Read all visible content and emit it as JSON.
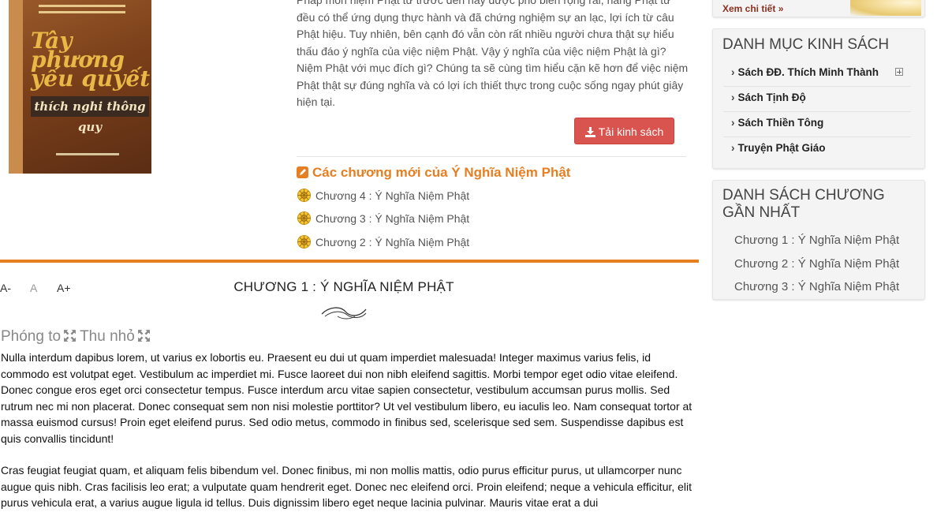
{
  "book": {
    "cover_title": "Tây phương yếu quyết",
    "cover_author": "thích nghi thông quy",
    "description": "Pháp môn niệm Phật từ trước đến nay được phổ biến rộng rãi, hàng Phật tử đều có thể ứng dụng thực hành và đã chứng nghiệm sự an lạc, lợi ích từ câu Phật hiệu. Tuy nhiên, bên cạnh đó vẫn còn rất nhiều người chưa thật sự hiểu thấu đáo ý nghĩa của việc niệm Phật. Vậy ý nghĩa của việc niệm Phật là gì? Niệm Phật với mục đích gì? Chúng ta sẽ cùng tìm hiểu cặn kẽ hơn để việc niệm Phật thật sự đúng nghĩa và có lợi ích thiết thực trong cuộc sống ngay phút giây hiện tại.",
    "download_label": "Tải kinh sách"
  },
  "new_chapters": {
    "title": "Các chương mới của Ý Nghĩa Niệm Phật",
    "items": [
      "Chương 4 : Ý Nghĩa Niệm Phật",
      "Chương 3 : Ý Nghĩa Niệm Phật",
      "Chương 2 : Ý Nghĩa Niệm Phật"
    ]
  },
  "reader": {
    "font_decrease": "A-",
    "font_normal": "A",
    "font_increase": "A+",
    "chapter_title": "CHƯƠNG 1 : Ý NGHĨA NIỆM PHẬT",
    "zoom_in": "Phóng to",
    "zoom_out": "Thu nhỏ",
    "paragraphs": [
      "Nulla interdum dapibus lorem, ut varius ex lobortis eu. Praesent eu dui ut quam imperdiet malesuada! Integer maximus varius felis, id commodo est volutpat eget. Vestibulum ac imperdiet mi. Fusce laoreet dui non nibh eleifend sagittis. Morbi tempor eget odio vitae eleifend. Donec congue eros eget orci consectetur tempus. Fusce interdum arcu vitae sapien consectetur, vestibulum accumsan purus mollis. Sed rutrum nec mi non placerat. Donec consequat sem non nisi molestie porttitor? Ut vel vestibulum libero, eu iaculis leo. Nam consequat tortor at massa euismod cursus! Proin eget eleifend purus. Sed odio metus, commodo in finibus sed, scelerisque sed sem. Suspendisse dapibus est quis convallis tincidunt!",
      "Cras feugiat feugiat quam, et aliquam felis bibendum vel. Donec finibus, mi non mollis mattis, odio purus efficitur purus, ut ullamcorper nunc augue quis nibh. Cras facilisis leo erat; a vulputate quam hendrerit eget. Donec nec eleifend orci. Proin eleifend; neque a vehicula efficitur, elit purus vehicula erat, a varius augue ligula id tellus. Duis dignissim libero eget neque lacinia pulvinar. Mauris vitae erat a dui"
    ]
  },
  "sidebar": {
    "more_link": "Xem chi tiết »",
    "categories_title": "DANH MỤC KINH SÁCH",
    "categories": [
      "Sách ĐĐ. Thích Minh Thành",
      "Sách Tịnh Độ",
      "Sách Thiền Tông",
      "Truyện Phật Giáo"
    ],
    "recent_title": "DANH SÁCH CHƯƠNG GẦN NHẤT",
    "recent": [
      "Chương 1 : Ý Nghĩa Niệm Phật",
      "Chương 2 : Ý Nghĩa Niệm Phật",
      "Chương 3 : Ý Nghĩa Niệm Phật"
    ]
  },
  "colors": {
    "accent": "#e67e22",
    "download_button": "#d9534f",
    "link_dark_red": "#8b2f1f"
  },
  "icons": [
    "download-icon",
    "edit-icon",
    "dharma-wheel-icon",
    "expand-icon",
    "plus-box-icon"
  ]
}
